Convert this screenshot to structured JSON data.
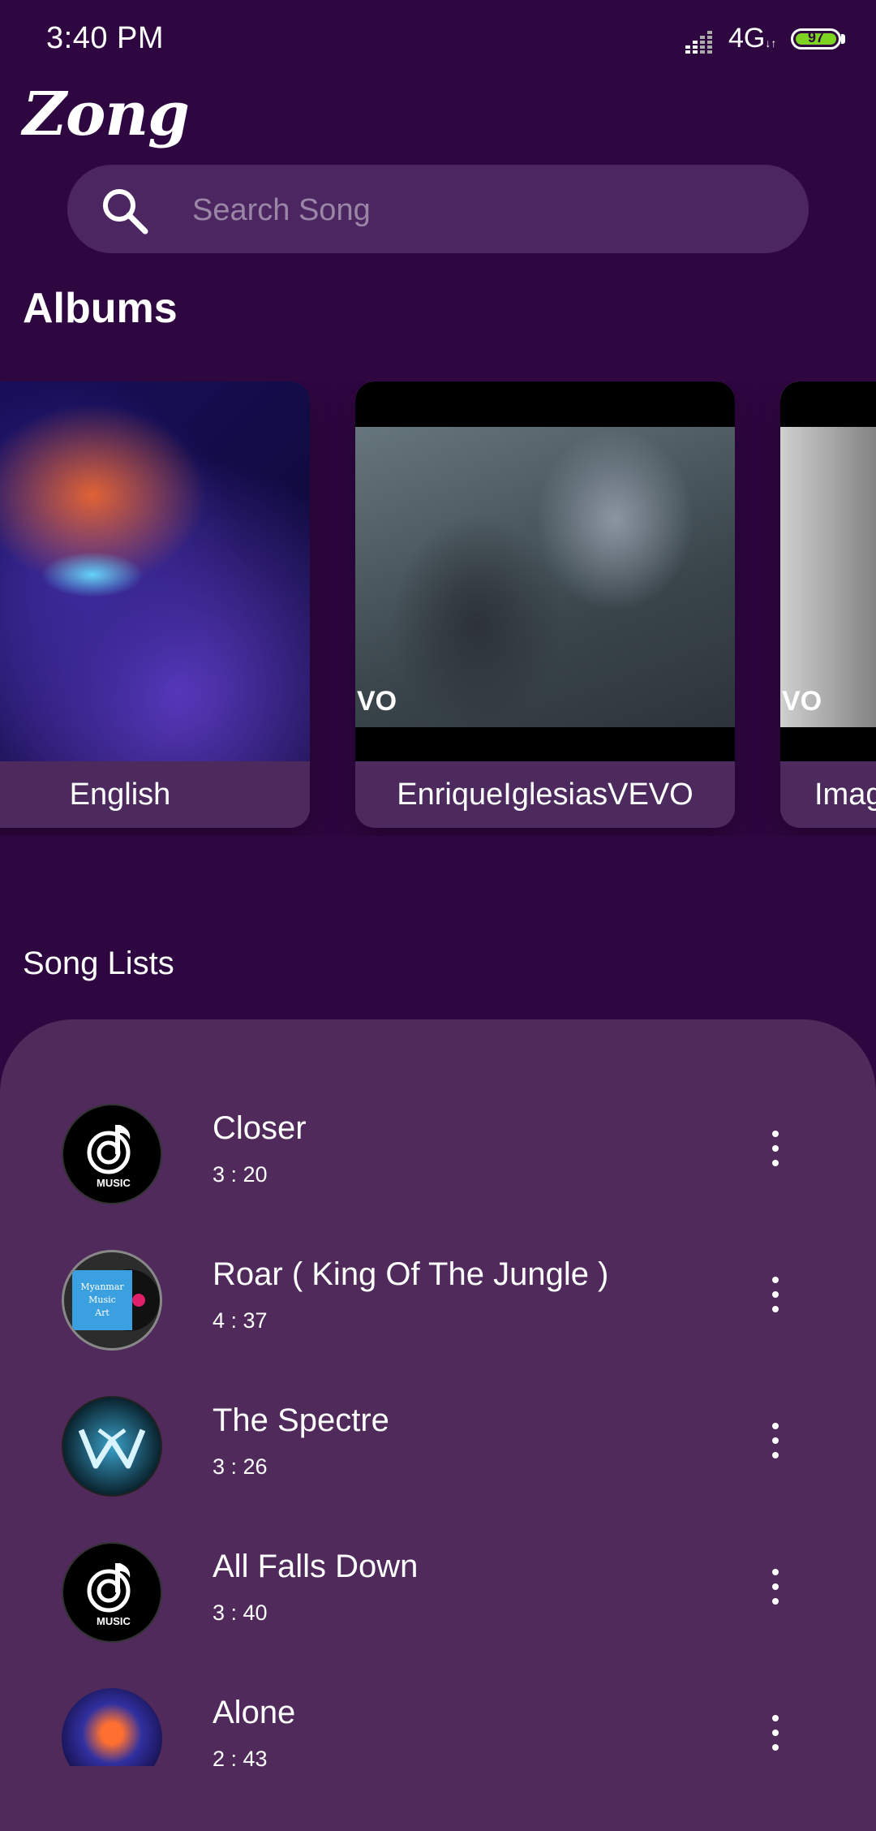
{
  "status_bar": {
    "time": "3:40 PM",
    "network": "4G",
    "battery": "97",
    "battery_color": "#7ed321"
  },
  "app": {
    "logo": "Zong"
  },
  "search": {
    "placeholder": "Search Song",
    "value": ""
  },
  "albums": {
    "title": "Albums",
    "items": [
      {
        "label": "English"
      },
      {
        "label": "EnriqueIglesiasVEVO"
      },
      {
        "label": "Imag"
      }
    ]
  },
  "songs": {
    "title": "Song Lists",
    "items": [
      {
        "title": "Closer",
        "duration": "3 : 20",
        "icon": "music-logo-icon"
      },
      {
        "title": "Roar ( King Of The Jungle )",
        "duration": "4 : 37",
        "icon": "myanmar-music-art-icon"
      },
      {
        "title": "The Spectre",
        "duration": "3 : 26",
        "icon": "alan-walker-icon"
      },
      {
        "title": "All Falls Down",
        "duration": "3 : 40",
        "icon": "music-logo-icon"
      },
      {
        "title": "Alone",
        "duration": "2 : 43",
        "icon": "neon-face-icon"
      }
    ]
  },
  "colors": {
    "background": "#2e0640",
    "panel": "#4f2a5a",
    "search_bg": "#4c2660",
    "card_label_bg": "#4c2a5e"
  }
}
